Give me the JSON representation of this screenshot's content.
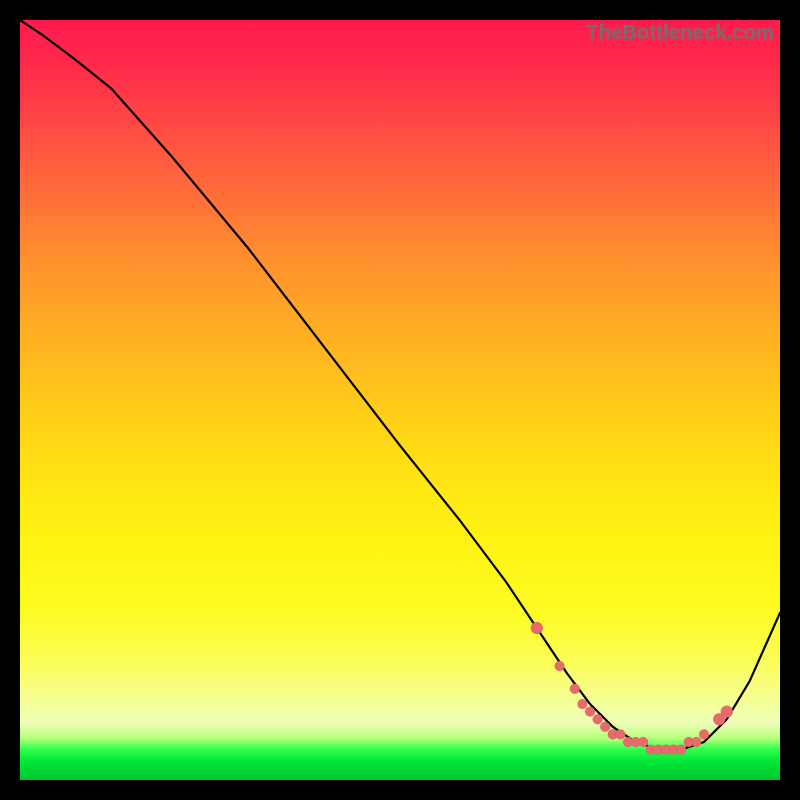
{
  "watermark": "TheBottleneck.com",
  "colors": {
    "dot": "#e96a6a",
    "line": "#000000",
    "frame_bg": "#000000"
  },
  "chart_data": {
    "type": "line",
    "title": "",
    "xlabel": "",
    "ylabel": "",
    "xlim": [
      0,
      100
    ],
    "ylim": [
      0,
      100
    ],
    "background": "vertical-gradient red→yellow→green",
    "series": [
      {
        "name": "bottleneck-curve",
        "x": [
          0,
          3,
          7,
          12,
          20,
          30,
          40,
          50,
          58,
          64,
          68,
          72,
          75,
          78,
          81,
          84,
          87,
          90,
          93,
          96,
          100
        ],
        "y": [
          100,
          98,
          95,
          91,
          82,
          70,
          57,
          44,
          34,
          26,
          20,
          14,
          10,
          7,
          5,
          4,
          4,
          5,
          8,
          13,
          22
        ]
      }
    ],
    "highlight_points": {
      "name": "bottom-valley-dots",
      "x": [
        68,
        71,
        73,
        74,
        75,
        76,
        77,
        78,
        79,
        80,
        81,
        82,
        83,
        84,
        85,
        86,
        87,
        88,
        89,
        90,
        92,
        93
      ],
      "y": [
        20,
        15,
        12,
        10,
        9,
        8,
        7,
        6,
        6,
        5,
        5,
        5,
        4,
        4,
        4,
        4,
        4,
        5,
        5,
        6,
        8,
        9
      ]
    }
  }
}
